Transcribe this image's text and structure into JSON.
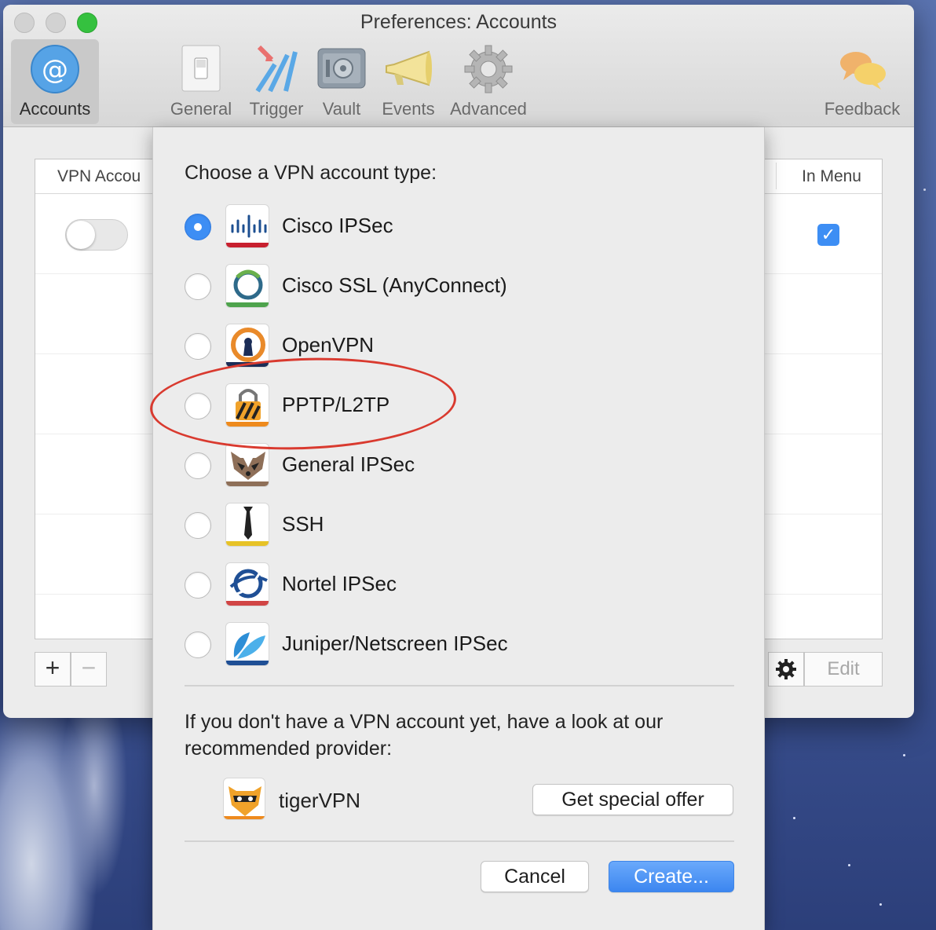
{
  "window": {
    "title": "Preferences: Accounts"
  },
  "toolbar": {
    "items": [
      {
        "label": "Accounts",
        "icon": "at-sign-icon",
        "active": true
      },
      {
        "label": "General",
        "icon": "switch-icon"
      },
      {
        "label": "Trigger",
        "icon": "trigger-icon"
      },
      {
        "label": "Vault",
        "icon": "vault-icon"
      },
      {
        "label": "Events",
        "icon": "megaphone-icon"
      },
      {
        "label": "Advanced",
        "icon": "gear-icon"
      },
      {
        "label": "Feedback",
        "icon": "speech-bubbles-icon"
      }
    ]
  },
  "accounts_table": {
    "col_vpn": "VPN Accou",
    "col_in_menu": "In Menu",
    "row_toggle_on": false,
    "row_in_menu_checked": true
  },
  "controls": {
    "add": "+",
    "remove": "−",
    "edit": "Edit"
  },
  "sheet": {
    "heading": "Choose a VPN account type:",
    "options": [
      {
        "label": "Cisco IPSec",
        "selected": true,
        "accent": "#c8202f"
      },
      {
        "label": "Cisco SSL (AnyConnect)",
        "selected": false,
        "accent": "#4ea34c"
      },
      {
        "label": "OpenVPN",
        "selected": false,
        "accent": "#1b2d57"
      },
      {
        "label": "PPTP/L2TP",
        "selected": false,
        "accent": "#ee8a1d"
      },
      {
        "label": "General IPSec",
        "selected": false,
        "accent": "#8e6f58"
      },
      {
        "label": "SSH",
        "selected": false,
        "accent": "#e7c226"
      },
      {
        "label": "Nortel IPSec",
        "selected": false,
        "accent": "#d14545"
      },
      {
        "label": "Juniper/Netscreen IPSec",
        "selected": false,
        "accent": "#1f4f95"
      }
    ],
    "hint": "If you don't have a VPN account yet, have a look at our recommended provider:",
    "provider": "tigerVPN",
    "offer_button": "Get special offer",
    "cancel_button": "Cancel",
    "create_button": "Create..."
  }
}
